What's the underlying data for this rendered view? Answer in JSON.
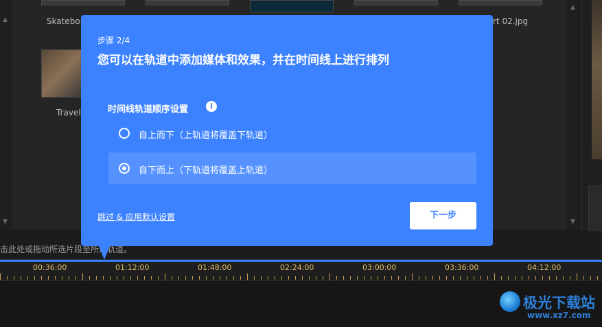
{
  "library": {
    "items": [
      {
        "label": "Skatebo"
      },
      {
        "label": "rt 02.jpg"
      },
      {
        "label": "Travel"
      }
    ],
    "scroll_up": "▲",
    "scroll_down": "▼"
  },
  "hint": {
    "text": "击此处或拖动所选片段至所选轨道。"
  },
  "ruler": {
    "ticks": [
      "00:36:00",
      "01:12:00",
      "01:48:00",
      "02:24:00",
      "03:00:00",
      "03:36:00",
      "04:12:00"
    ]
  },
  "dialog": {
    "step": "步骤 2/4",
    "title": "您可以在轨道中添加媒体和效果，并在时间线上进行排列",
    "section_title": "时间线轨道顺序设置",
    "info_icon_glyph": "i",
    "options": [
      {
        "label": "自上而下（上轨道将覆盖下轨道）",
        "selected": false
      },
      {
        "label": "自下而上（下轨道将覆盖上轨道）",
        "selected": true
      }
    ],
    "skip_label": "跳过 & 应用默认设置",
    "next_label": "下一步"
  },
  "watermark": {
    "name": "极光下载站",
    "url": "www.xz7.com"
  },
  "colors": {
    "accent": "#3c82ff",
    "ruler_tick": "#e0c070"
  }
}
